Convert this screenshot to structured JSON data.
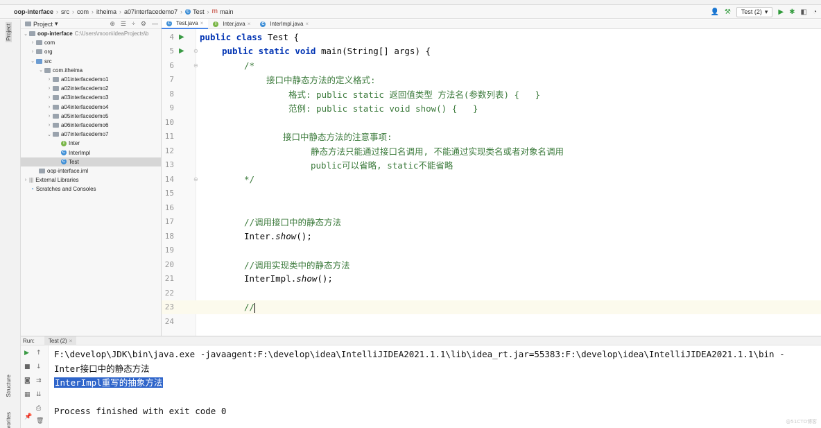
{
  "navbar": {
    "crumbs": [
      "oop-interface",
      "src",
      "com",
      "itheima",
      "a07interfacedemo7",
      "Test",
      "main"
    ],
    "run_config": "Test (2)"
  },
  "stripe": {
    "project_label": "Project",
    "structure_label": "Structure",
    "favorites_label": "Favorites"
  },
  "project": {
    "header": "Project",
    "root": {
      "name": "oop-interface",
      "path": "C:\\Users\\moon\\IdeaProjects\\b"
    },
    "items": {
      "com": "com",
      "org": "org",
      "src": "src",
      "com_itheima": "com.itheima",
      "d1": "a01interfacedemo1",
      "d2": "a02interfacedemo2",
      "d3": "a03interfacedemo3",
      "d4": "a04interfacedemo4",
      "d5": "a05interfacedemo5",
      "d6": "a06interfacedemo6",
      "d7": "a07interfacedemo7",
      "inter": "Inter",
      "interimpl": "InterImpl",
      "test": "Test",
      "iml": "oop-interface.iml",
      "ext": "External Libraries",
      "scratches": "Scratches and Consoles"
    }
  },
  "editor": {
    "tabs": [
      "Test.java",
      "Inter.java",
      "InterImpl.java"
    ],
    "line_numbers": [
      "4",
      "5",
      "6",
      "7",
      "8",
      "9",
      "10",
      "11",
      "12",
      "13",
      "14",
      "15",
      "16",
      "17",
      "18",
      "19",
      "20",
      "21",
      "22",
      "23",
      "24"
    ],
    "code": {
      "l4_kw": "public class ",
      "l4_rest": "Test {",
      "l5_kw": "public static void ",
      "l5_rest": "main(String[] args) {",
      "l6": "/*",
      "l7": "接口中静态方法的定义格式:",
      "l8": "格式: public static 返回值类型 方法名(参数列表) {   }",
      "l9": "范例: public static void show() {   }",
      "l11": "接口中静态方法的注意事项:",
      "l12": "静态方法只能通过接口名调用, 不能通过实现类名或者对象名调用",
      "l13": "public可以省略, static不能省略",
      "l14": "*/",
      "l17": "//调用接口中的静态方法",
      "l18_a": "Inter.",
      "l18_b": "show",
      "l18_c": "();",
      "l20": "//调用实现类中的静态方法",
      "l21_a": "InterImpl.",
      "l21_b": "show",
      "l21_c": "();",
      "l23": "//"
    }
  },
  "run": {
    "label": "Run:",
    "tab": "Test (2)",
    "output": [
      "F:\\develop\\JDK\\bin\\java.exe -javaagent:F:\\develop\\idea\\IntelliJIDEA2021.1.1\\lib\\idea_rt.jar=55383:F:\\develop\\idea\\IntelliJIDEA2021.1.1\\bin -",
      "Inter接口中的静态方法",
      "InterImpl重写的抽象方法",
      "",
      "Process finished with exit code 0"
    ]
  },
  "watermark": "@51CTO博客",
  "colors": {
    "keyword": "#0033b3",
    "comment": "#3b7a3b",
    "selection": "#2f65ca",
    "run_green": "#3a9a44"
  }
}
